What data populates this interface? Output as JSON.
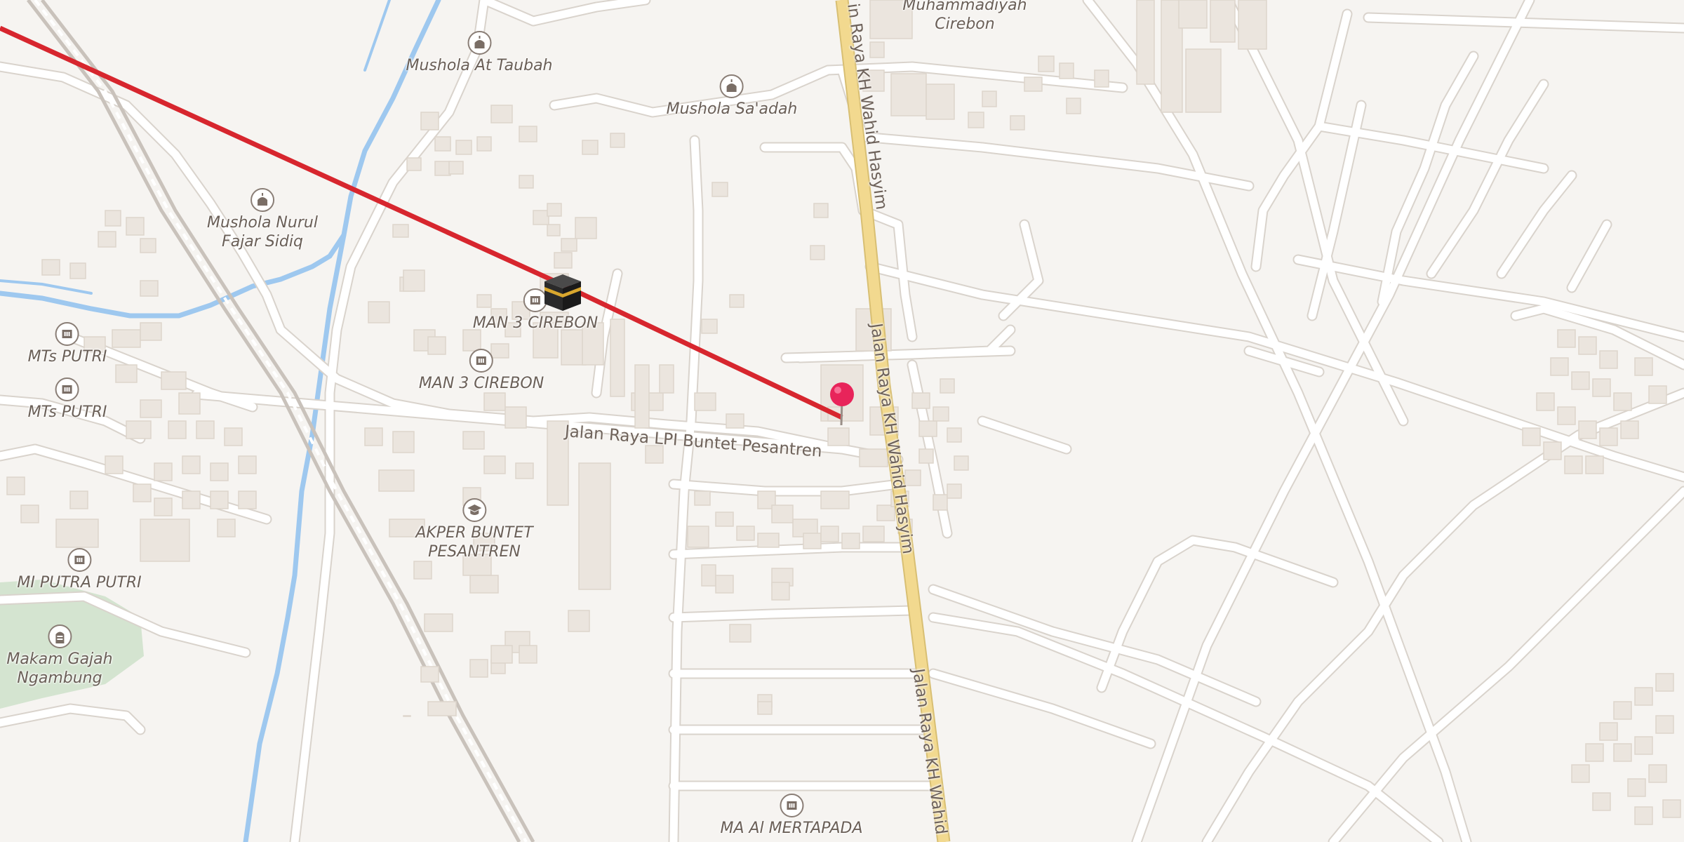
{
  "map": {
    "route_color": "#d7262e",
    "main_road_color": "#f2d98f",
    "water_color": "#9ec8ef",
    "pin_color": "#e8245a"
  },
  "road_labels": {
    "lpi": "Jalan Raya LPI Buntet Pesantren",
    "kh_wahid_top": "in Raya KH Wahid Hasyim",
    "kh_wahid_mid": "Jalan Raya KH Wahid Hasyim",
    "kh_wahid_bottom": "Jalan Raya KH Wahid"
  },
  "pois": {
    "mushola_at_taubah": {
      "label": "Mushola At Taubah",
      "icon": "mosque-icon"
    },
    "mushola_saadah": {
      "label": "Mushola Sa'adah",
      "icon": "mosque-icon"
    },
    "muhammadiyah": {
      "label": "Muhammadiyah\nCirebon",
      "icon": "none"
    },
    "mushola_nurul": {
      "label": "Mushola Nurul\nFajar Sidiq",
      "icon": "mosque-icon"
    },
    "man3_a": {
      "label": "MAN 3 CIREBON",
      "icon": "school-icon"
    },
    "man3_b": {
      "label": "MAN 3 CIREBON",
      "icon": "school-icon"
    },
    "mts_a": {
      "label": "MTs PUTRI",
      "icon": "school-icon"
    },
    "mts_b": {
      "label": "MTs PUTRI",
      "icon": "school-icon"
    },
    "akper": {
      "label": "AKPER BUNTET\nPESANTREN",
      "icon": "graduation-cap-icon"
    },
    "mi_putra": {
      "label": "MI PUTRA PUTRI",
      "icon": "school-icon"
    },
    "makam": {
      "label": "Makam Gajah\nNgambung",
      "icon": "cemetery-icon"
    },
    "ma_mertapada": {
      "label": "MA Al MERTAPADA",
      "icon": "school-icon"
    }
  },
  "markers": {
    "kaaba": {
      "icon": "kaaba-icon"
    },
    "location_pin": {
      "icon": "map-pin-icon"
    }
  }
}
